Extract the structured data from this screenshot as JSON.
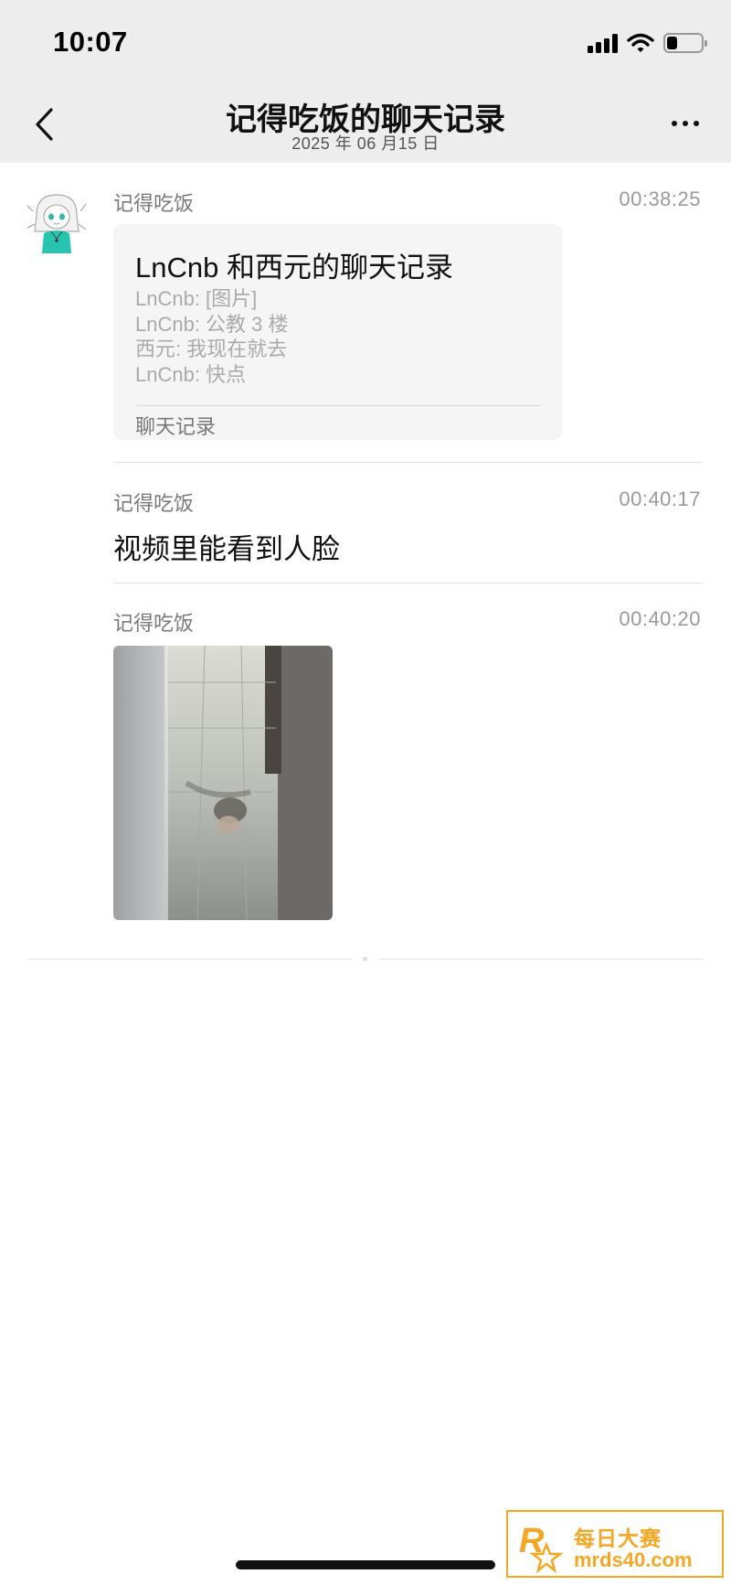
{
  "status_bar": {
    "time": "10:07",
    "battery_level": 0.3
  },
  "nav": {
    "title": "记得吃饭的聊天记录",
    "subtitle": "2025 年 06 月15 日"
  },
  "messages": [
    {
      "sender": "记得吃饭",
      "time": "00:38:25",
      "card": {
        "title": "LnCnb 和西元的聊天记录",
        "lines": [
          "LnCnb: [图片]",
          "LnCnb: 公教 3 楼",
          "西元: 我现在就去",
          "LnCnb: 快点"
        ],
        "footer": "聊天记录"
      }
    },
    {
      "sender": "记得吃饭",
      "time": "00:40:17",
      "text": "视频里能看到人脸"
    },
    {
      "sender": "记得吃饭",
      "time": "00:40:20",
      "image": "photo"
    }
  ],
  "watermark": {
    "line1": "每日大赛",
    "line2": "mrds40.com",
    "logo_text": "R"
  },
  "icons": {
    "back": "chevron-left-icon",
    "more": "more-dots-icon",
    "signal": "signal-icon",
    "wifi": "wifi-icon",
    "battery": "battery-icon"
  },
  "colors": {
    "header_bg": "#ededed",
    "card_bg": "#f5f5f5",
    "secondary_text": "#7a7a7a",
    "watermark_accent": "#f5a623"
  }
}
